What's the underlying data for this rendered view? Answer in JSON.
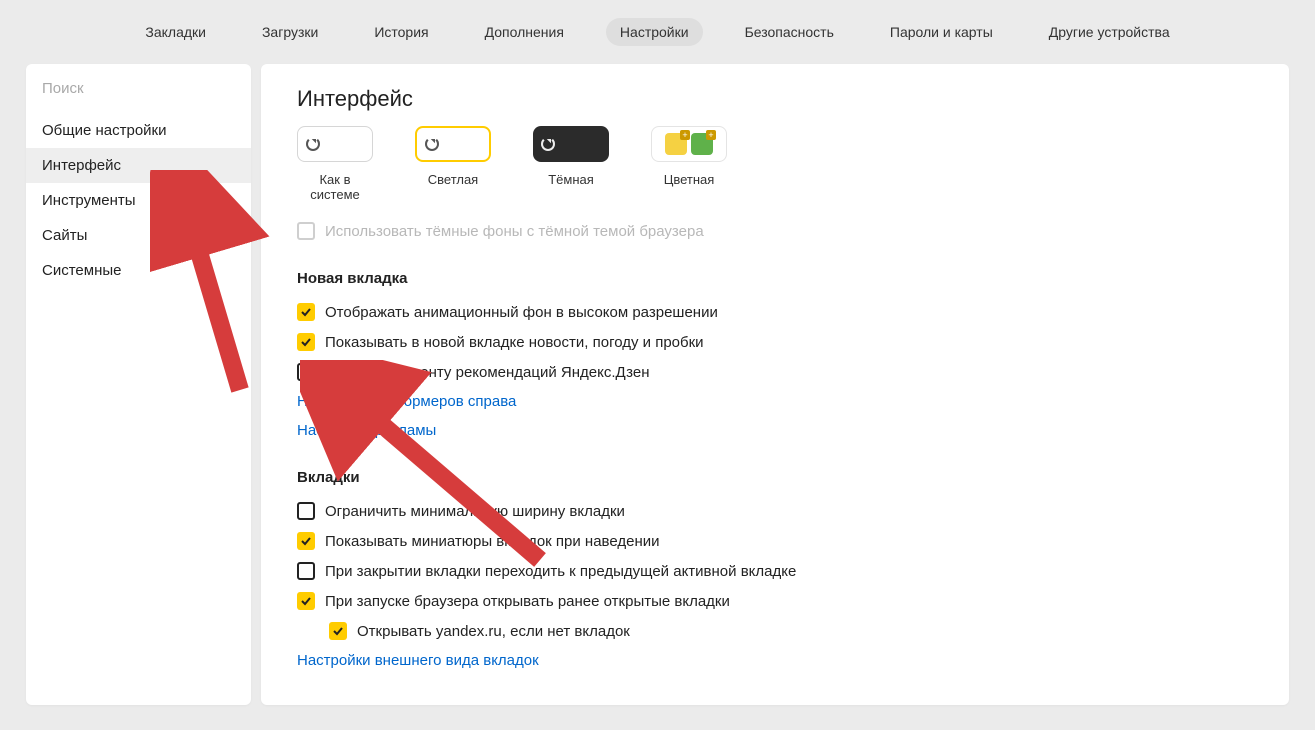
{
  "topbar": {
    "items": [
      {
        "label": "Закладки",
        "active": false
      },
      {
        "label": "Загрузки",
        "active": false
      },
      {
        "label": "История",
        "active": false
      },
      {
        "label": "Дополнения",
        "active": false
      },
      {
        "label": "Настройки",
        "active": true
      },
      {
        "label": "Безопасность",
        "active": false
      },
      {
        "label": "Пароли и карты",
        "active": false
      },
      {
        "label": "Другие устройства",
        "active": false
      }
    ]
  },
  "sidebar": {
    "search_placeholder": "Поиск",
    "items": [
      {
        "label": "Общие настройки",
        "active": false
      },
      {
        "label": "Интерфейс",
        "active": true
      },
      {
        "label": "Инструменты",
        "active": false
      },
      {
        "label": "Сайты",
        "active": false
      },
      {
        "label": "Системные",
        "active": false
      }
    ]
  },
  "main": {
    "title": "Интерфейс",
    "themes": [
      {
        "id": "system",
        "label": "Как в системе"
      },
      {
        "id": "light",
        "label": "Светлая"
      },
      {
        "id": "dark",
        "label": "Тёмная"
      },
      {
        "id": "color",
        "label": "Цветная"
      }
    ],
    "dark_bg_option": {
      "checked": false,
      "enabled": false,
      "label": "Использовать тёмные фоны с тёмной темой браузера"
    },
    "section_newtab": {
      "title": "Новая вкладка",
      "options": [
        {
          "checked": true,
          "label": "Отображать анимационный фон в высоком разрешении"
        },
        {
          "checked": true,
          "label": "Показывать в новой вкладке новости, погоду и пробки"
        },
        {
          "checked": false,
          "label": "Показывать ленту рекомендаций Яндекс.Дзен"
        }
      ],
      "links": [
        "Настройки информеров справа",
        "Настройки рекламы"
      ]
    },
    "section_tabs": {
      "title": "Вкладки",
      "options": [
        {
          "checked": false,
          "label": "Ограничить минимальную ширину вкладки"
        },
        {
          "checked": true,
          "label": "Показывать миниатюры вкладок при наведении"
        },
        {
          "checked": false,
          "label": "При закрытии вкладки переходить к предыдущей активной вкладке"
        },
        {
          "checked": true,
          "label": "При запуске браузера открывать ранее открытые вкладки"
        }
      ],
      "sub_option": {
        "checked": true,
        "label": "Открывать yandex.ru, если нет вкладок"
      },
      "link": "Настройки внешнего вида вкладок"
    }
  },
  "colors": {
    "tile_yellow": "#f5d142",
    "tile_green": "#5fb14a"
  }
}
